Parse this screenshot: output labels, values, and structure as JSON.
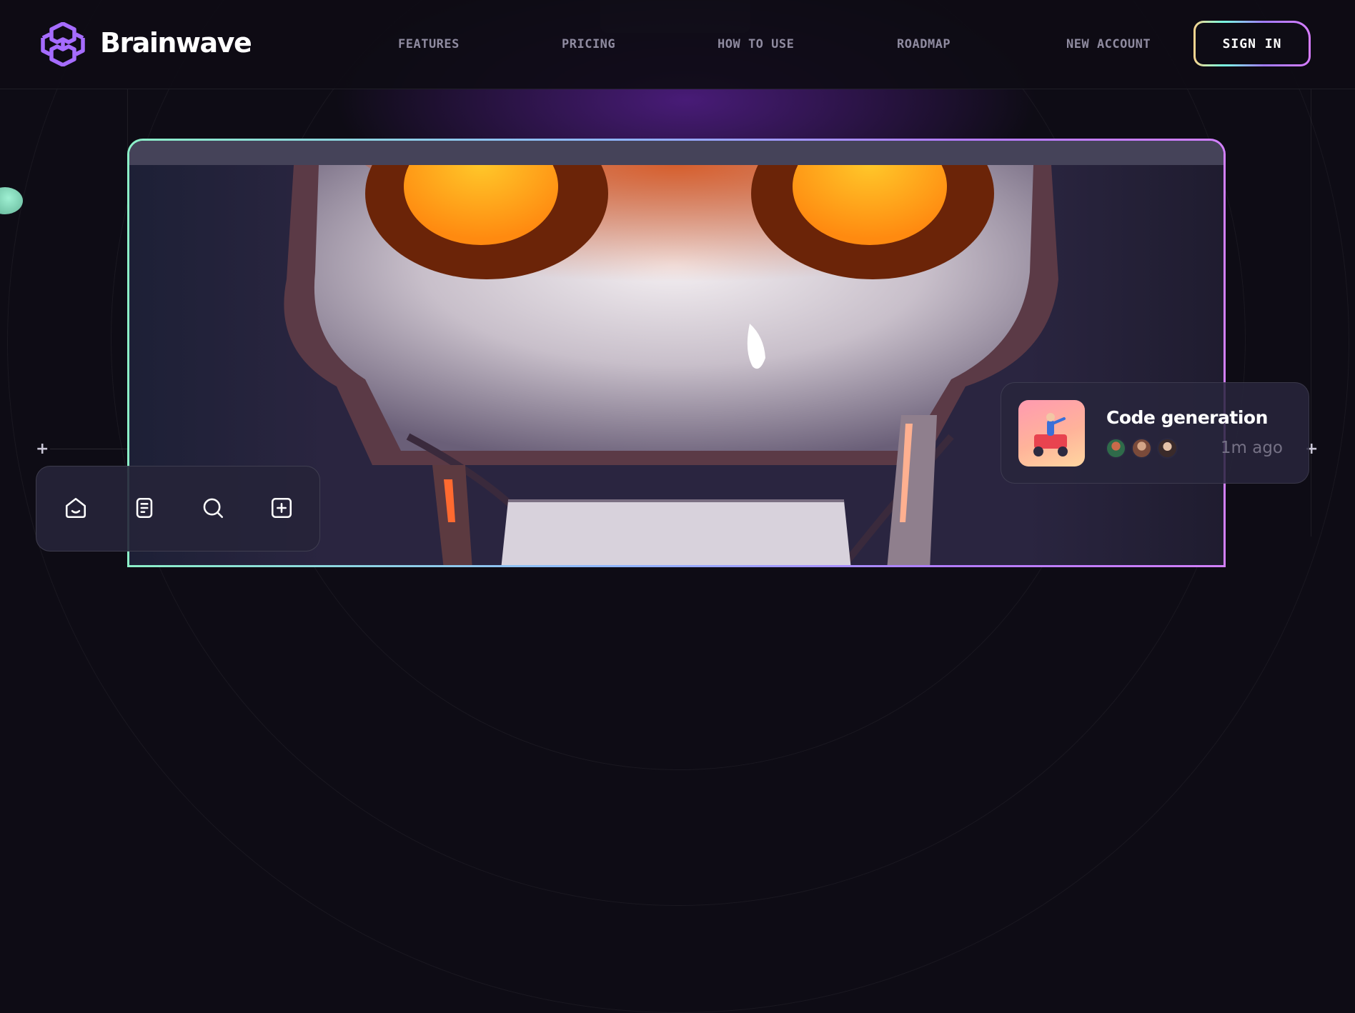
{
  "brand": {
    "name": "Brainwave",
    "logo_icon": "brainwave-logo-icon",
    "accent": "#a27cff"
  },
  "nav": {
    "items": [
      {
        "label": "FEATURES"
      },
      {
        "label": "PRICING"
      },
      {
        "label": "HOW TO USE"
      },
      {
        "label": "ROADMAP"
      }
    ],
    "new_account": "NEW ACCOUNT",
    "sign_in": "SIGN IN"
  },
  "hero": {
    "image": "robot-face-with-glowing-orange-eyes"
  },
  "toolbar": {
    "buttons": [
      {
        "icon": "home-icon"
      },
      {
        "icon": "document-icon"
      },
      {
        "icon": "search-icon"
      },
      {
        "icon": "add-square-icon"
      }
    ]
  },
  "notification": {
    "title": "Code generation",
    "time": "1m ago",
    "thumbnail": "rider-on-cart-illustration",
    "avatars": [
      "avatar-1",
      "avatar-2",
      "avatar-3"
    ]
  }
}
